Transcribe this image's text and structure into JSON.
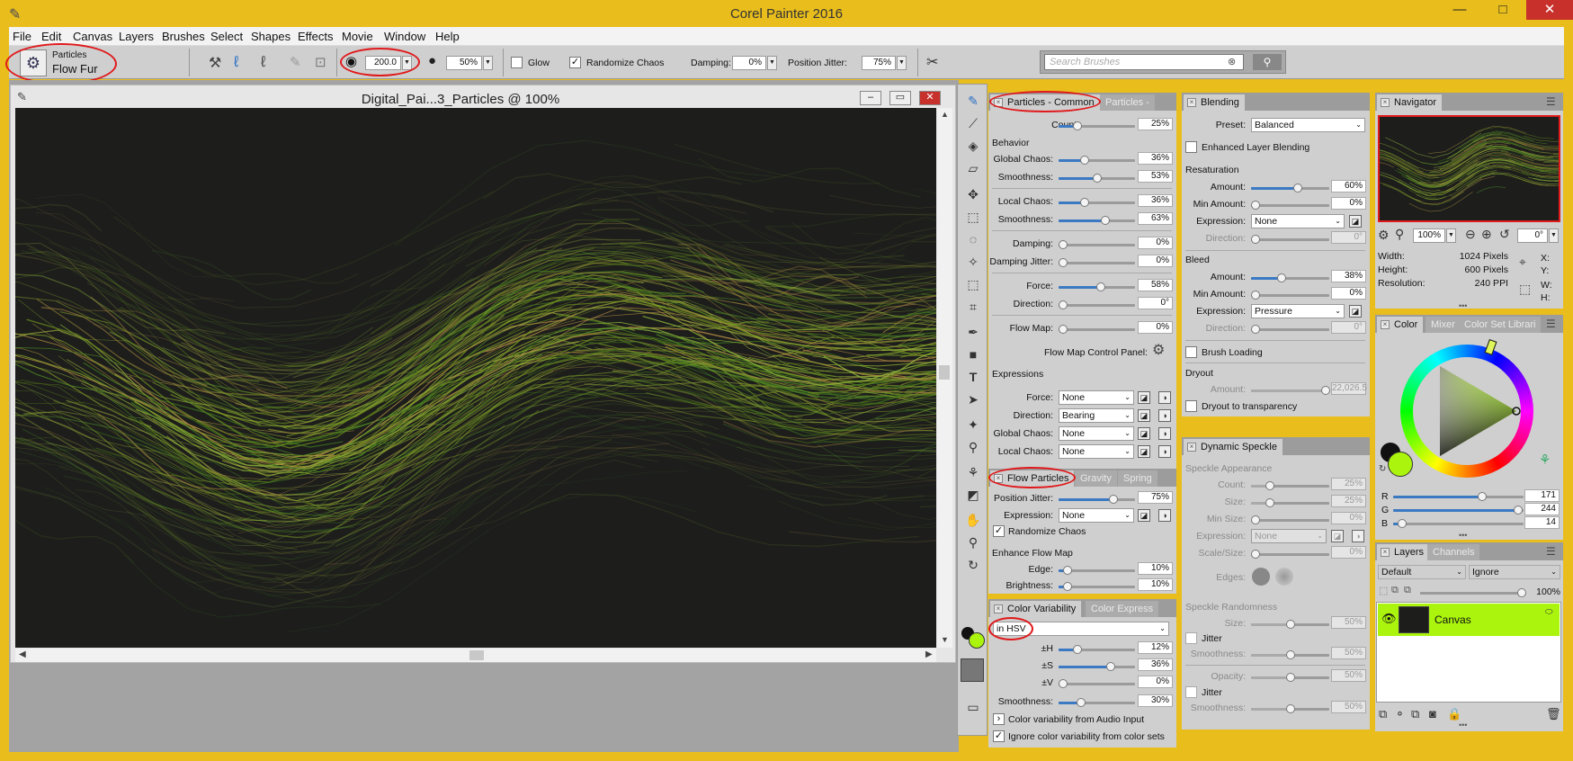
{
  "app": {
    "title": "Corel Painter 2016"
  },
  "window_controls": {
    "minimize": "—",
    "maximize": "□",
    "close": "✕"
  },
  "menu": [
    "File",
    "Edit",
    "Canvas",
    "Layers",
    "Brushes",
    "Select",
    "Shapes",
    "Effects",
    "Movie",
    "Window",
    "Help"
  ],
  "propbar": {
    "brush_category": "Particles",
    "brush_variant": "Flow Fur",
    "size": "200.0",
    "opacity": "50%",
    "glow_label": "Glow",
    "randomize_chaos_label": "Randomize Chaos",
    "damping_label": "Damping:",
    "damping_value": "0%",
    "position_jitter_label": "Position Jitter:",
    "position_jitter_value": "75%",
    "search_placeholder": "Search Brushes"
  },
  "document": {
    "title": "Digital_Pai...3_Particles @ 100%"
  },
  "particles_common": {
    "tab": "Particles - Common",
    "tab2": "Particles -",
    "count_label": "Count:",
    "count": "25%",
    "behavior": "Behavior",
    "global_chaos_label": "Global Chaos:",
    "global_chaos": "36%",
    "smoothness_label": "Smoothness:",
    "smoothness1": "53%",
    "local_chaos_label": "Local Chaos:",
    "local_chaos": "36%",
    "smoothness2": "63%",
    "damping_label": "Damping:",
    "damping": "0%",
    "damping_jitter_label": "Damping Jitter:",
    "damping_jitter": "0%",
    "force_label": "Force:",
    "force": "58%",
    "direction_label": "Direction:",
    "direction": "0°",
    "flow_map_label": "Flow Map:",
    "flow_map": "0%",
    "flow_map_control": "Flow Map Control Panel:",
    "expressions": "Expressions",
    "exp_force_label": "Force:",
    "exp_force": "None",
    "exp_direction_label": "Direction:",
    "exp_direction": "Bearing",
    "exp_global_label": "Global Chaos:",
    "exp_global": "None",
    "exp_local_label": "Local Chaos:",
    "exp_local": "None"
  },
  "flow_particles": {
    "tab": "Flow Particles",
    "tab2": "Gravity",
    "tab3": "Spring",
    "position_jitter_label": "Position Jitter:",
    "position_jitter": "75%",
    "expression_label": "Expression:",
    "expression": "None",
    "randomize_chaos": "Randomize Chaos",
    "enhance_flow_map": "Enhance Flow Map",
    "edge_label": "Edge:",
    "edge": "10%",
    "brightness_label": "Brightness:",
    "brightness": "10%"
  },
  "color_variability": {
    "tab": "Color Variability",
    "tab2": "Color Express",
    "mode": "in HSV",
    "h_label": "±H",
    "h": "12%",
    "s_label": "±S",
    "s": "36%",
    "v_label": "±V",
    "v": "0%",
    "smoothness_label": "Smoothness:",
    "smoothness": "30%",
    "audio": "Color variability from Audio Input",
    "ignore": "Ignore color variability from color sets"
  },
  "blending": {
    "tab": "Blending",
    "preset_label": "Preset:",
    "preset": "Balanced",
    "enhanced_layer": "Enhanced Layer Blending",
    "resaturation": "Resaturation",
    "amount_label": "Amount:",
    "res_amount": "60%",
    "min_amount_label": "Min Amount:",
    "res_min": "0%",
    "expression_label": "Expression:",
    "res_expression": "None",
    "direction_label": "Direction:",
    "res_direction": "0°",
    "bleed": "Bleed",
    "bleed_amount": "38%",
    "bleed_min": "0%",
    "bleed_expression": "Pressure",
    "bleed_direction": "0°",
    "brush_loading": "Brush Loading",
    "dryout": "Dryout",
    "dryout_amount_label": "Amount:",
    "dryout_amount": "22,026.5",
    "dryout_transparency": "Dryout to transparency"
  },
  "dynamic_speckle": {
    "tab": "Dynamic Speckle",
    "appearance": "Speckle Appearance",
    "count_label": "Count:",
    "count": "25%",
    "size_label": "Size:",
    "size": "25%",
    "min_size_label": "Min Size:",
    "min_size": "0%",
    "expression_label": "Expression:",
    "expression": "None",
    "scale_label": "Scale/Size:",
    "scale": "0%",
    "edges_label": "Edges:",
    "randomness": "Speckle Randomness",
    "r_size_label": "Size:",
    "r_size": "50%",
    "jitter_label": "Jitter",
    "smoothness_label": "Smoothness:",
    "smoothness1": "50%",
    "opacity_label": "Opacity:",
    "opacity": "50%",
    "smoothness2": "50%"
  },
  "navigator": {
    "tab": "Navigator",
    "zoom": "100%",
    "rotation": "0°",
    "width_label": "Width:",
    "width": "1024 Pixels",
    "height_label": "Height:",
    "height": "600 Pixels",
    "resolution_label": "Resolution:",
    "resolution": "240 PPI",
    "x_label": "X:",
    "y_label": "Y:",
    "w_label": "W:",
    "h_label": "H:"
  },
  "color": {
    "tab": "Color",
    "tab2": "Mixer",
    "tab3": "Color Set Librari",
    "r_label": "R",
    "r": "171",
    "g_label": "G",
    "g": "244",
    "b_label": "B",
    "b": "14",
    "main_color": "#abf40e"
  },
  "layers": {
    "tab": "Layers",
    "tab2": "Channels",
    "composite_method": "Default",
    "composite_depth": "Ignore",
    "opacity": "100%",
    "layer_name": "Canvas"
  }
}
